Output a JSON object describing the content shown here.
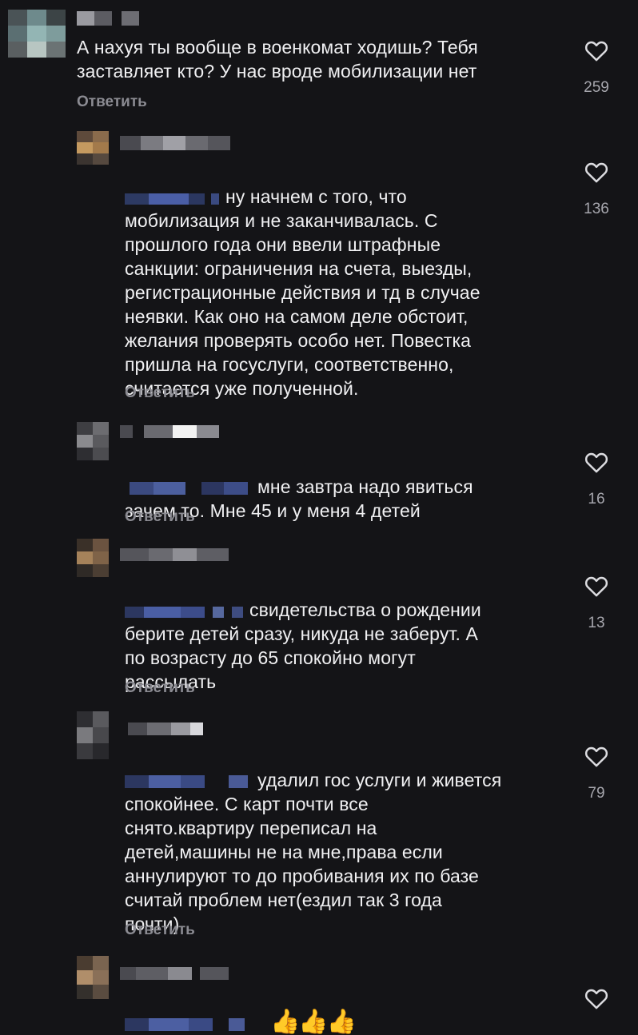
{
  "comments": [
    {
      "text": "А нахуя ты вообще в военкомат ходишь? Тебя\nзаставляет кто? У нас вроде мобилизации нет",
      "reply": "Ответить",
      "likes": "259",
      "liked": false
    },
    {
      "text": "ну начнем с того, что\nмобилизация и не заканчивалась. С\nпрошлого года они ввели штрафные\nсанкции: ограничения на счета, выезды,\nрегистрационные действия и тд в случае\nнеявки. Как оно на самом деле обстоит,\nжелания проверять особо нет. Повестка\nпришла на госуслуги, соответственно,\nсчитается уже полученной.",
      "reply": "Ответить",
      "likes": "136"
    },
    {
      "text": "мне завтра надо явиться\nзачем то. Мне 45 и у меня 4 детей",
      "reply": "Ответить",
      "likes": "16"
    },
    {
      "text": "свидетельства о рождении\nберите детей сразу, никуда не заберут. А\nпо возрасту до 65 спокойно могут\nрассылать",
      "reply": "Ответить",
      "likes": "13"
    },
    {
      "text": "удалил гос услуги и живется\nспокойнее. С карт почти все\nснято.квартиру переписал на\nдетей,машины не на мне,права если\nаннулируют то до пробивания их по базе\nсчитай проблем нет(ездил так 3 года\nпочти)",
      "reply": "Ответить",
      "likes": "79"
    },
    {
      "text": "👍👍👍",
      "likes": ""
    }
  ],
  "icons": {
    "like": "heart-outline-icon"
  },
  "colors": {
    "background": "#141417",
    "text": "#f0f0f2",
    "secondary": "#8b8b92",
    "heart": "#dcdce0"
  }
}
